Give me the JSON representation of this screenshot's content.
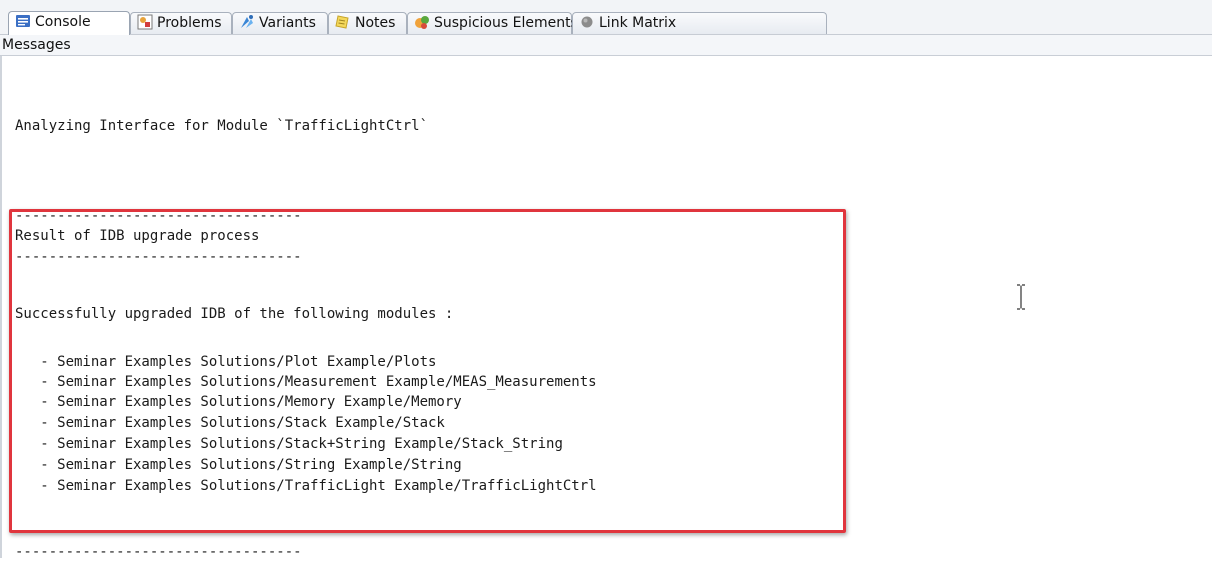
{
  "tabs": [
    {
      "label": "Console",
      "icon": "console-icon",
      "active": true
    },
    {
      "label": "Problems",
      "icon": "problems-icon",
      "active": false
    },
    {
      "label": "Variants",
      "icon": "variants-icon",
      "active": false
    },
    {
      "label": "Notes",
      "icon": "notes-icon",
      "active": false
    },
    {
      "label": "Suspicious Elements",
      "icon": "suspicious-elements-icon",
      "active": false
    },
    {
      "label": "Link Matrix",
      "icon": "link-matrix-icon",
      "active": false
    }
  ],
  "messages_label": "Messages",
  "console": {
    "analyzing_line": "Analyzing Interface for Module `TrafficLightCtrl`",
    "separator": "----------------------------------",
    "result_title": "Result of IDB upgrade process",
    "success_line": "Successfully upgraded IDB of the following modules :",
    "modules": [
      "   - Seminar Examples Solutions/Plot Example/Plots",
      "   - Seminar Examples Solutions/Measurement Example/MEAS_Measurements",
      "   - Seminar Examples Solutions/Memory Example/Memory",
      "   - Seminar Examples Solutions/Stack Example/Stack",
      "   - Seminar Examples Solutions/Stack+String Example/Stack_String",
      "   - Seminar Examples Solutions/String Example/String",
      "   - Seminar Examples Solutions/TrafficLight Example/TrafficLightCtrl"
    ]
  },
  "colors": {
    "highlight_border": "#e0353d",
    "tab_border": "#a9b1bd"
  }
}
